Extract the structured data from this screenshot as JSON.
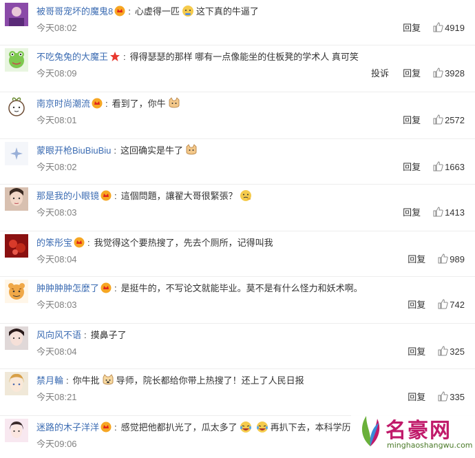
{
  "comments": [
    {
      "user": "被哥哥宠坏的魔鬼8",
      "content": "心虚得一匹",
      "content2": "这下真的牛逼了",
      "time": "今天08:02",
      "reply": "回复",
      "likes": "4919"
    },
    {
      "user": "不吃兔兔的大魔王",
      "content": "得得瑟瑟的那样 哪有一点像能坐的住板凳的学术人 真可笑",
      "time": "今天08:09",
      "report": "投诉",
      "reply": "回复",
      "likes": "3928"
    },
    {
      "user": "南京时尚潮流",
      "content": "看到了，你牛",
      "time": "今天08:01",
      "reply": "回复",
      "likes": "2572"
    },
    {
      "user": "蒙眼开枪BiuBiuBiu",
      "content": "这回确实是牛了",
      "time": "今天08:02",
      "reply": "回复",
      "likes": "1663"
    },
    {
      "user": "那是我的小眼镜",
      "content": "這個問題，讓翟大哥很緊張？",
      "time": "今天08:03",
      "reply": "回复",
      "likes": "1413"
    },
    {
      "user": "的笨彤宝",
      "content": "我觉得这个要热搜了，先去个厕所，记得叫我",
      "time": "今天08:04",
      "reply": "回复",
      "likes": "989"
    },
    {
      "user": "肿肿肿肿怎麼了",
      "content": "是挺牛的，不写论文就能毕业。莫不是有什么怪力和妖术啊。",
      "time": "今天08:03",
      "reply": "回复",
      "likes": "742"
    },
    {
      "user": "风向风不语",
      "content": "摸鼻子了",
      "time": "今天08:04",
      "reply": "回复",
      "likes": "325"
    },
    {
      "user": "禁月輪",
      "content": "你牛批",
      "content2": "导师，院长都给你带上热搜了！还上了人民日报",
      "time": "今天08:21",
      "reply": "回复",
      "likes": "335"
    },
    {
      "user": "迷路的木子洋洋",
      "content": "感觉把他都扒光了，瓜太多了",
      "content2": "再扒下去，本科学历",
      "time": "今天09:06",
      "reply": "回复",
      "likes": ""
    }
  ],
  "watermark": {
    "title": "名豪网",
    "url": "minghaoshangwu.com"
  },
  "colors": {
    "username": "#eb7350",
    "time": "#808080",
    "text": "#333333"
  }
}
